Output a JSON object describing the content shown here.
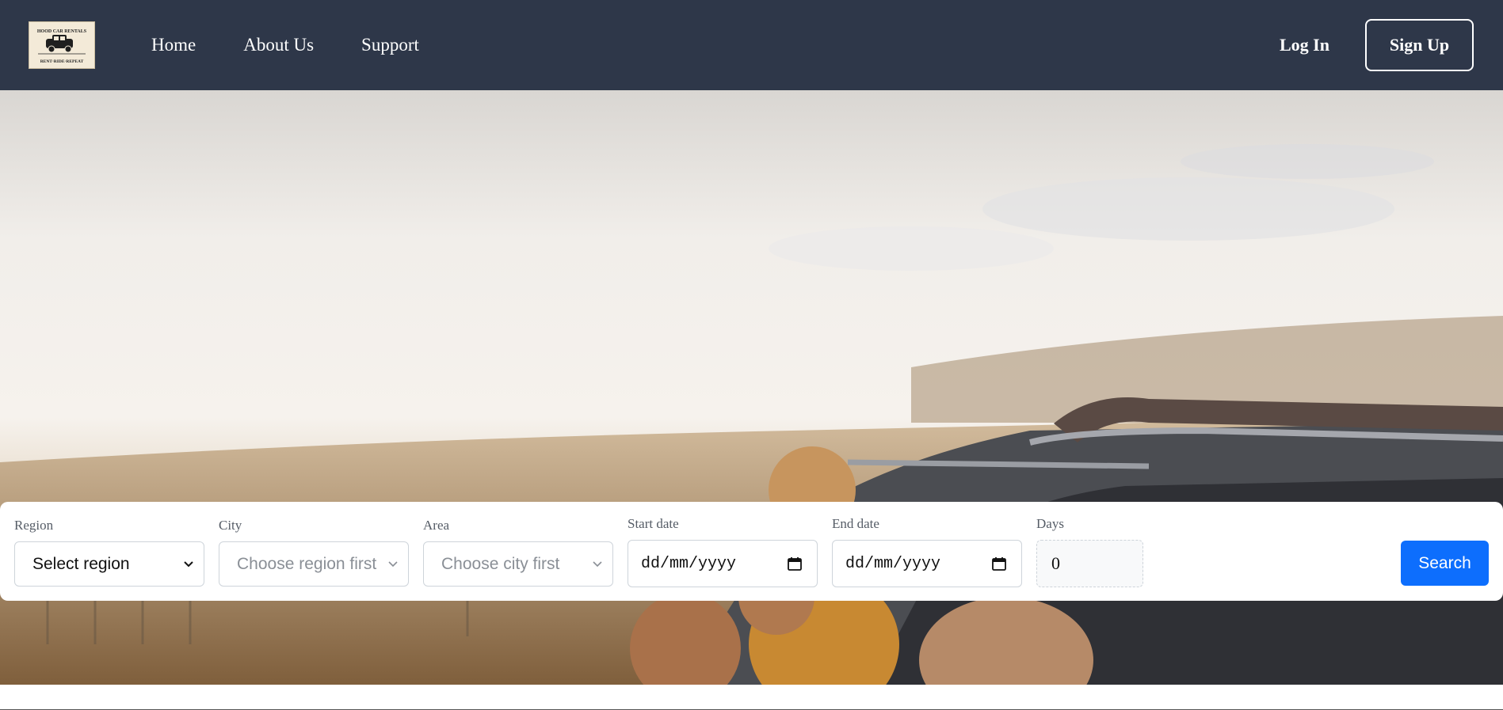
{
  "brand": {
    "logo_top_text": "HOOD CAR RENTALS",
    "logo_bottom_text": "RENT·RIDE·REPEAT"
  },
  "nav": {
    "links": [
      "Home",
      "About Us",
      "Support"
    ],
    "login_label": "Log In",
    "signup_label": "Sign Up"
  },
  "search": {
    "region": {
      "label": "Region",
      "value": "Select region"
    },
    "city": {
      "label": "City",
      "value": "Choose region first"
    },
    "area": {
      "label": "Area",
      "value": "Choose city first"
    },
    "start_date": {
      "label": "Start date",
      "value": "dd/mm/yyyy"
    },
    "end_date": {
      "label": "End date",
      "value": "dd/mm/yyyy"
    },
    "days": {
      "label": "Days",
      "value": "0"
    },
    "button_label": "Search"
  },
  "colors": {
    "navbar": "#2e3749",
    "primary": "#0d6efd",
    "white": "#ffffff"
  },
  "icons": {
    "dropdown": "chevron-down-icon",
    "date": "calendar-icon"
  }
}
